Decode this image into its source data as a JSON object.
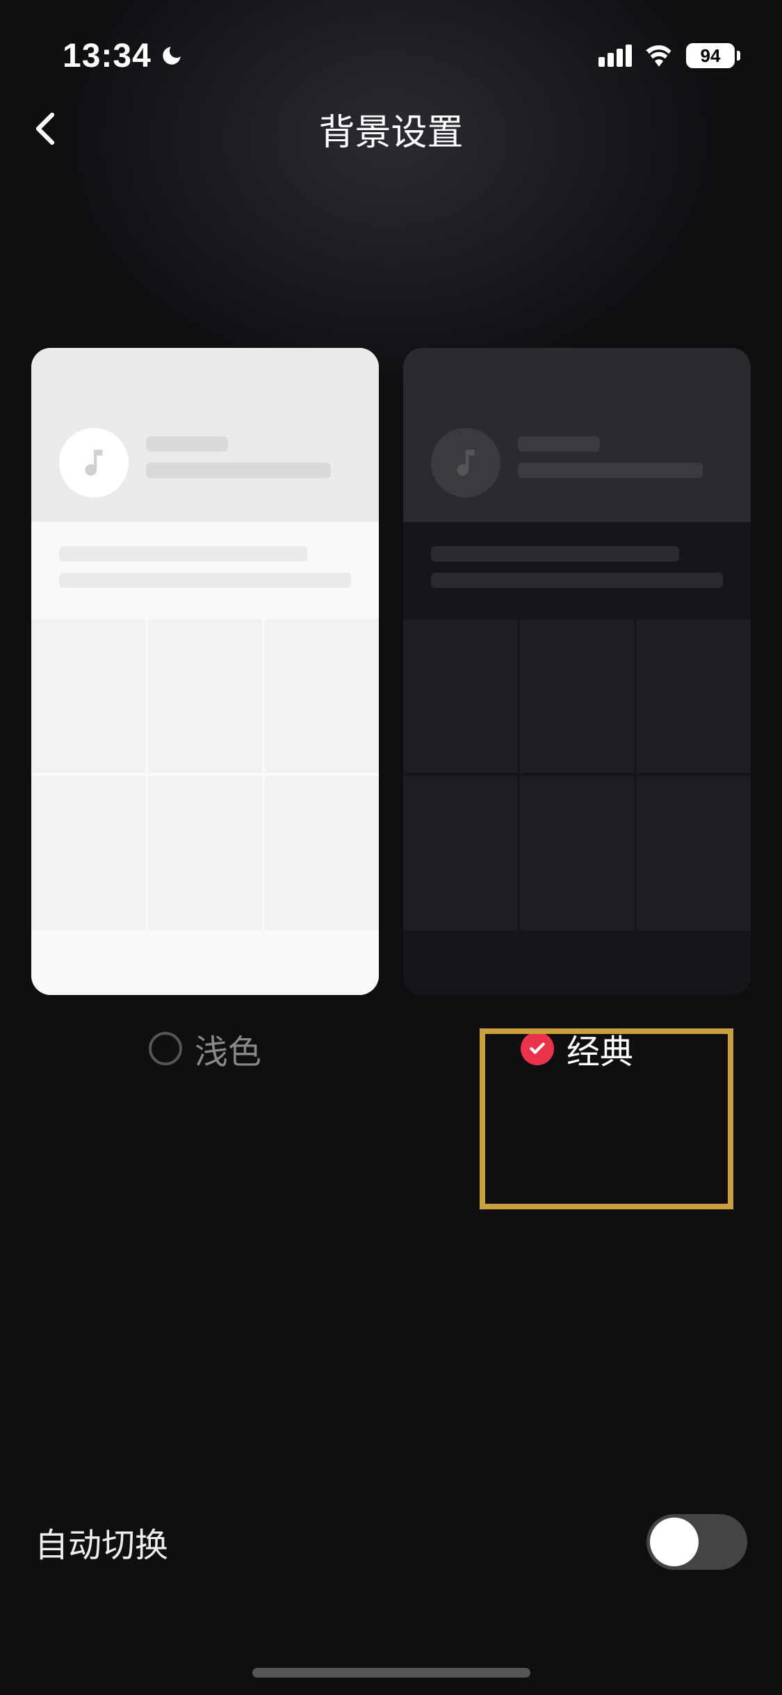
{
  "statusBar": {
    "time": "13:34",
    "batteryPercent": "94"
  },
  "header": {
    "title": "背景设置"
  },
  "themes": {
    "light": {
      "label": "浅色",
      "selected": false
    },
    "dark": {
      "label": "经典",
      "selected": true
    }
  },
  "autoSwitch": {
    "label": "自动切换",
    "enabled": false
  }
}
